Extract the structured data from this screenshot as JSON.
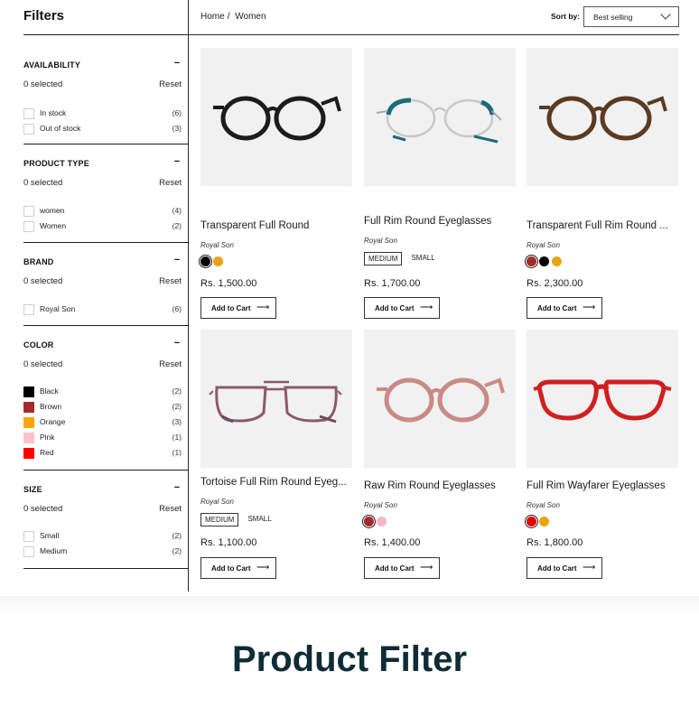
{
  "sidebar": {
    "title": "Filters",
    "sections": [
      {
        "heading": "AVAILABILITY",
        "selected": "0 selected",
        "reset": "Reset",
        "options": [
          {
            "label": "In stock",
            "count": "(6)"
          },
          {
            "label": "Out of stock",
            "count": "(3)"
          }
        ]
      },
      {
        "heading": "PRODUCT TYPE",
        "selected": "0 selected",
        "reset": "Reset",
        "options": [
          {
            "label": "women",
            "count": "(4)"
          },
          {
            "label": "Women",
            "count": "(2)"
          }
        ]
      },
      {
        "heading": "BRAND",
        "selected": "0 selected",
        "reset": "Reset",
        "options": [
          {
            "label": "Royal Son",
            "count": "(6)"
          }
        ]
      },
      {
        "heading": "COLOR",
        "selected": "0 selected",
        "reset": "Reset",
        "options": [
          {
            "label": "Black",
            "count": "(2)",
            "color": "#000000"
          },
          {
            "label": "Brown",
            "count": "(2)",
            "color": "#a52a2a"
          },
          {
            "label": "Orange",
            "count": "(3)",
            "color": "#ffa500"
          },
          {
            "label": "Pink",
            "count": "(1)",
            "color": "#ffc0cb"
          },
          {
            "label": "Red",
            "count": "(1)",
            "color": "#ff0000"
          }
        ]
      },
      {
        "heading": "SIZE",
        "selected": "0 selected",
        "reset": "Reset",
        "options": [
          {
            "label": "Small",
            "count": "(2)"
          },
          {
            "label": "Medium",
            "count": "(2)"
          }
        ]
      }
    ]
  },
  "breadcrumb": {
    "home": "Home",
    "separator": "/",
    "current": "Women"
  },
  "sort": {
    "label": "Sort by:",
    "value": "Best selling"
  },
  "products": [
    {
      "title": "Transparent Full Round",
      "brand": "Royal Son",
      "price": "Rs. 1,500.00",
      "cart": "Add to Cart",
      "arrow": "⟶",
      "swatches": [
        "#000000",
        "#e8a317"
      ],
      "selected_swatch": 0,
      "sizes": [],
      "frame_color": "#1c1c1c",
      "lens_style": "round"
    },
    {
      "title": "Full Rim Round Eyeglasses",
      "brand": "Royal Son",
      "price": "Rs. 1,700.00",
      "cart": "Add to Cart",
      "arrow": "⟶",
      "swatches": [],
      "sizes": [
        "MEDIUM",
        "SMALL"
      ],
      "selected_size": 0,
      "frame_color": "#1d6a7a",
      "lens_style": "wire"
    },
    {
      "title": "Transparent Full Rim Round ...",
      "brand": "Royal Son",
      "price": "Rs. 2,300.00",
      "cart": "Add to Cart",
      "arrow": "⟶",
      "swatches": [
        "#a52a2a",
        "#000000",
        "#e8a317"
      ],
      "selected_swatch": 0,
      "sizes": [],
      "frame_color": "#5a3b22",
      "lens_style": "round"
    },
    {
      "title": "Tortoise Full Rim Round Eyeg...",
      "brand": "Royal Son",
      "price": "Rs. 1,100.00",
      "cart": "Add to Cart",
      "arrow": "⟶",
      "swatches": [],
      "sizes": [
        "MEDIUM",
        "SMALL"
      ],
      "selected_size": 0,
      "frame_color": "#8a5a6a",
      "lens_style": "aviator"
    },
    {
      "title": "Raw Rim Round Eyeglasses",
      "brand": "Royal Son",
      "price": "Rs. 1,400.00",
      "cart": "Add to Cart",
      "arrow": "⟶",
      "swatches": [
        "#a52a2a",
        "#f7b8c4"
      ],
      "selected_swatch": 0,
      "sizes": [],
      "frame_color": "#c98a86",
      "lens_style": "round"
    },
    {
      "title": "Full Rim Wayfarer Eyeglasses",
      "brand": "Royal Son",
      "price": "Rs. 1,800.00",
      "cart": "Add to Cart",
      "arrow": "⟶",
      "swatches": [
        "#e00000",
        "#e8a317"
      ],
      "selected_swatch": 0,
      "sizes": [],
      "frame_color": "#d01f1f",
      "lens_style": "wayfarer"
    }
  ],
  "banner": {
    "title": "Product Filter"
  }
}
